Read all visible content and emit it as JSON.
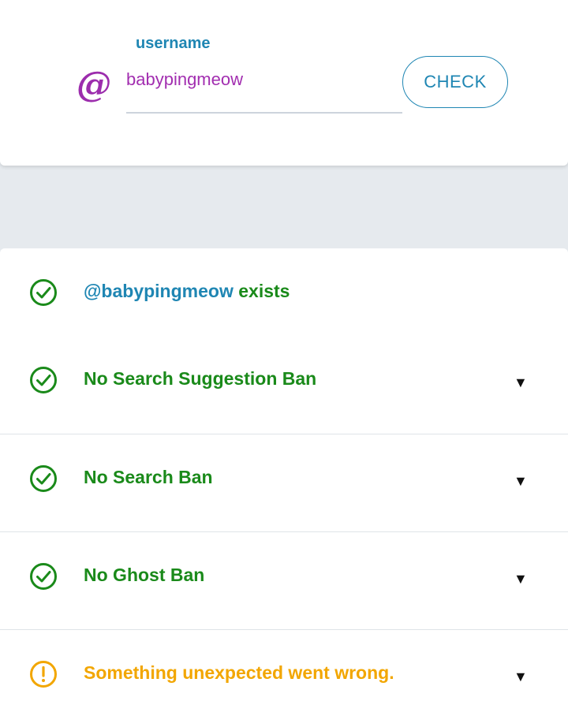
{
  "form": {
    "label": "username",
    "at_symbol": "@",
    "username_value": "babypingmeow",
    "check_label": "CHECK"
  },
  "results": {
    "exists": {
      "handle": "@babypingmeow",
      "suffix": " exists",
      "status": "ok"
    },
    "items": [
      {
        "label": "No Search Suggestion Ban",
        "status": "ok",
        "toggle": "▼"
      },
      {
        "label": "No Search Ban",
        "status": "ok",
        "toggle": "▼"
      },
      {
        "label": "No Ghost Ban",
        "status": "ok",
        "toggle": "▼"
      },
      {
        "label": "Something unexpected went wrong.",
        "status": "warning",
        "toggle": "▼"
      }
    ]
  },
  "colors": {
    "accent": "#1f86b3",
    "username": "#a22eb0",
    "ok": "#1a8a1a",
    "warning": "#f2a600",
    "background": "#e6eaee"
  },
  "icons": {
    "ok": "check-circle-icon",
    "warning": "exclamation-circle-icon",
    "at": "at-sign-icon",
    "toggle": "triangle-down-icon"
  }
}
